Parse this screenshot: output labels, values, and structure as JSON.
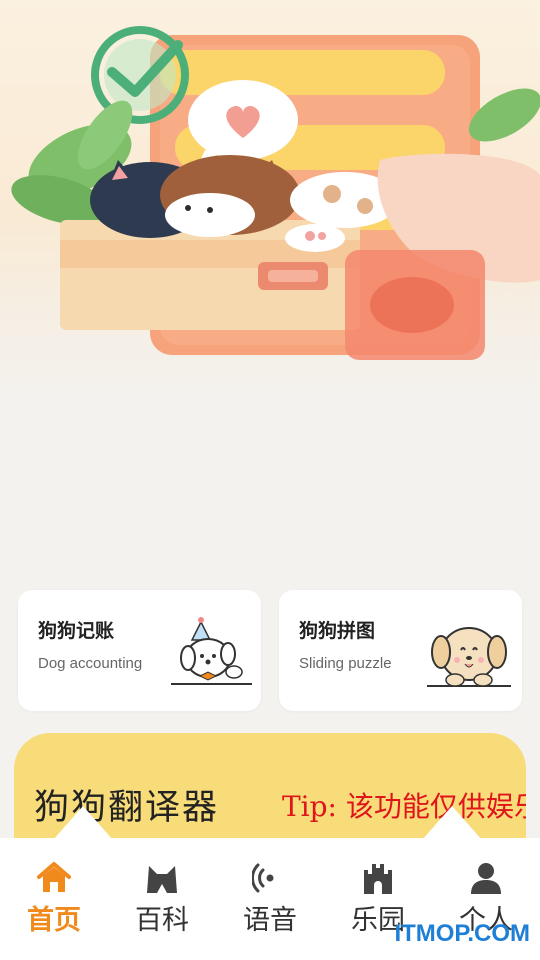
{
  "hero": {
    "illustration": "cats-in-box-with-checklist"
  },
  "cards": [
    {
      "title": "狗狗记账",
      "subtitle": "Dog accounting",
      "icon": "party-dog-icon"
    },
    {
      "title": "狗狗拼图",
      "subtitle": "Sliding puzzle",
      "icon": "happy-dog-icon"
    }
  ],
  "translator": {
    "title": "狗狗翻译器",
    "tip": "Tip: 该功能仅供娱乐"
  },
  "nav": {
    "items": [
      {
        "label": "首页",
        "icon": "home-icon",
        "active": true
      },
      {
        "label": "百科",
        "icon": "cat-icon",
        "active": false
      },
      {
        "label": "语音",
        "icon": "voice-icon",
        "active": false
      },
      {
        "label": "乐园",
        "icon": "castle-icon",
        "active": false
      },
      {
        "label": "个人",
        "icon": "user-icon",
        "active": false
      }
    ]
  },
  "watermark": "ITMOP.COM",
  "colors": {
    "accent": "#f08a1c",
    "banner": "#f8dc7a",
    "tip_red": "#e0141b",
    "background": "#f3f2ee"
  }
}
